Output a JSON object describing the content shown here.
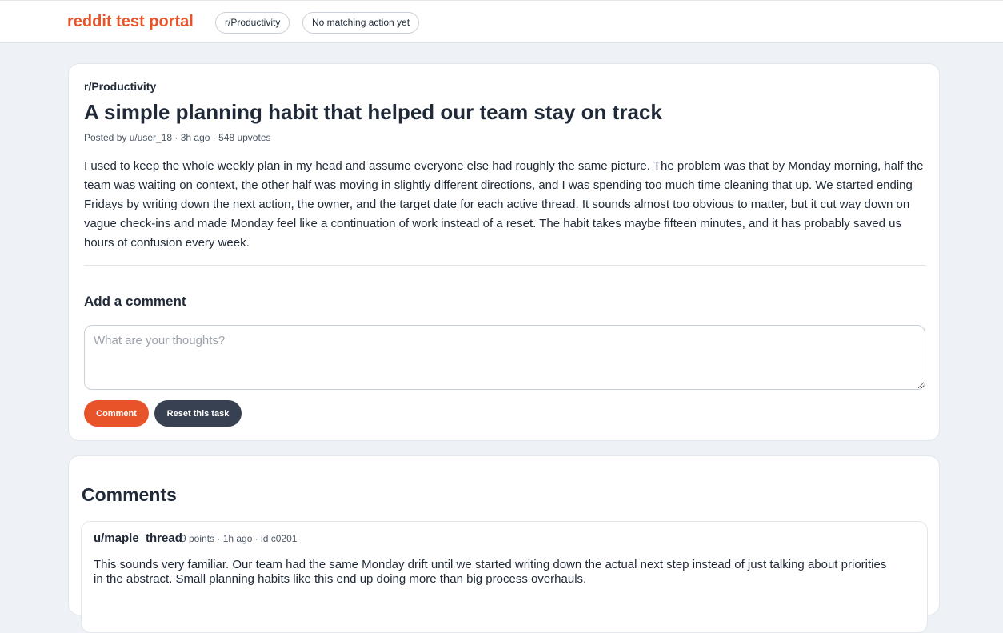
{
  "header": {
    "brand": "reddit test portal",
    "subreddit_pill": "r/Productivity",
    "status_pill": "No matching action yet"
  },
  "post": {
    "subreddit": "r/Productivity",
    "title": "A simple planning habit that helped our team stay on track",
    "meta": "Posted by u/user_18 · 3h ago · 548 upvotes",
    "body": "I used to keep the whole weekly plan in my head and assume everyone else had roughly the same picture. The problem was that by Monday morning, half the team was waiting on context, the other half was moving in slightly different directions, and I was spending too much time cleaning that up. We started ending Fridays by writing down the next action, the owner, and the target date for each active thread. It sounds almost too obvious to matter, but it cut way down on vague check-ins and made Monday feel like a continuation of work instead of a reset. The habit takes maybe fifteen minutes, and it has probably saved us hours of confusion every week."
  },
  "add_comment": {
    "heading": "Add a comment",
    "placeholder": "What are your thoughts?",
    "value": "",
    "comment_button": "Comment",
    "reset_button": "Reset this task"
  },
  "comments": {
    "heading": "Comments",
    "items": [
      {
        "author": "u/maple_thread",
        "meta": "9 points · 1h ago · id c0201",
        "text": "This sounds very familiar. Our team had the same Monday drift until we started writing down the actual next step instead of just talking about priorities in the abstract. Small planning habits like this end up doing more than big process overhauls."
      }
    ]
  },
  "colors": {
    "brand": "#e8532a",
    "page_background": "#eef1f6",
    "reset_button": "#374151"
  }
}
